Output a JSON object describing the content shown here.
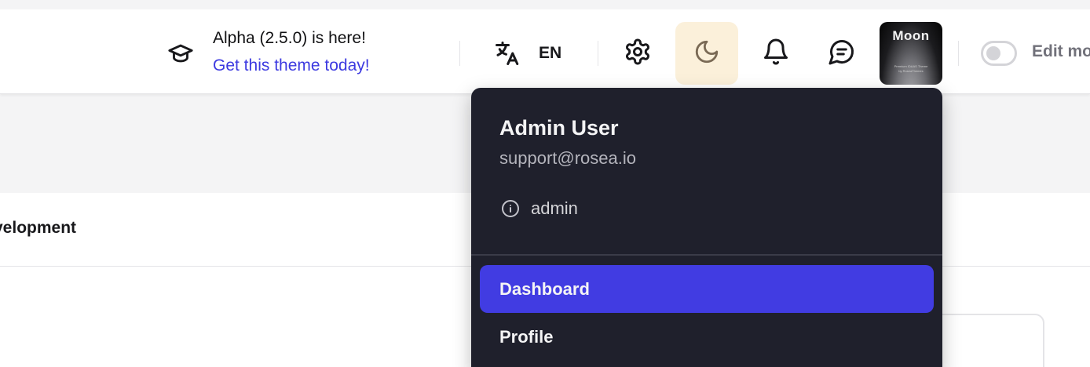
{
  "header": {
    "announcement": {
      "title": "Alpha (2.5.0) is here!",
      "link": "Get this theme today!",
      "icon": "graduation-cap-icon"
    },
    "language": {
      "icon": "translate-icon",
      "code": "EN"
    },
    "icons": [
      "gear-icon",
      "moon-icon",
      "bell-icon",
      "chat-icon"
    ],
    "active_icon": "moon-icon",
    "avatar": {
      "word": "Moon",
      "subtitle_1": "Premium IDAAS Theme",
      "subtitle_2": "by RoseaThemes"
    },
    "edit_mode": {
      "label": "Edit mo",
      "enabled": false
    }
  },
  "page": {
    "band_text": "velopment"
  },
  "user_menu": {
    "name": "Admin User",
    "email": "support@rosea.io",
    "role": "admin",
    "role_icon": "info-icon",
    "items": [
      {
        "label": "Dashboard",
        "active": true
      },
      {
        "label": "Profile",
        "active": false
      }
    ]
  },
  "colors": {
    "accent": "#413ce2",
    "link": "#3d3ae0",
    "menu_bg": "#1f202c",
    "active_icon_bg": "#fbf0da"
  }
}
